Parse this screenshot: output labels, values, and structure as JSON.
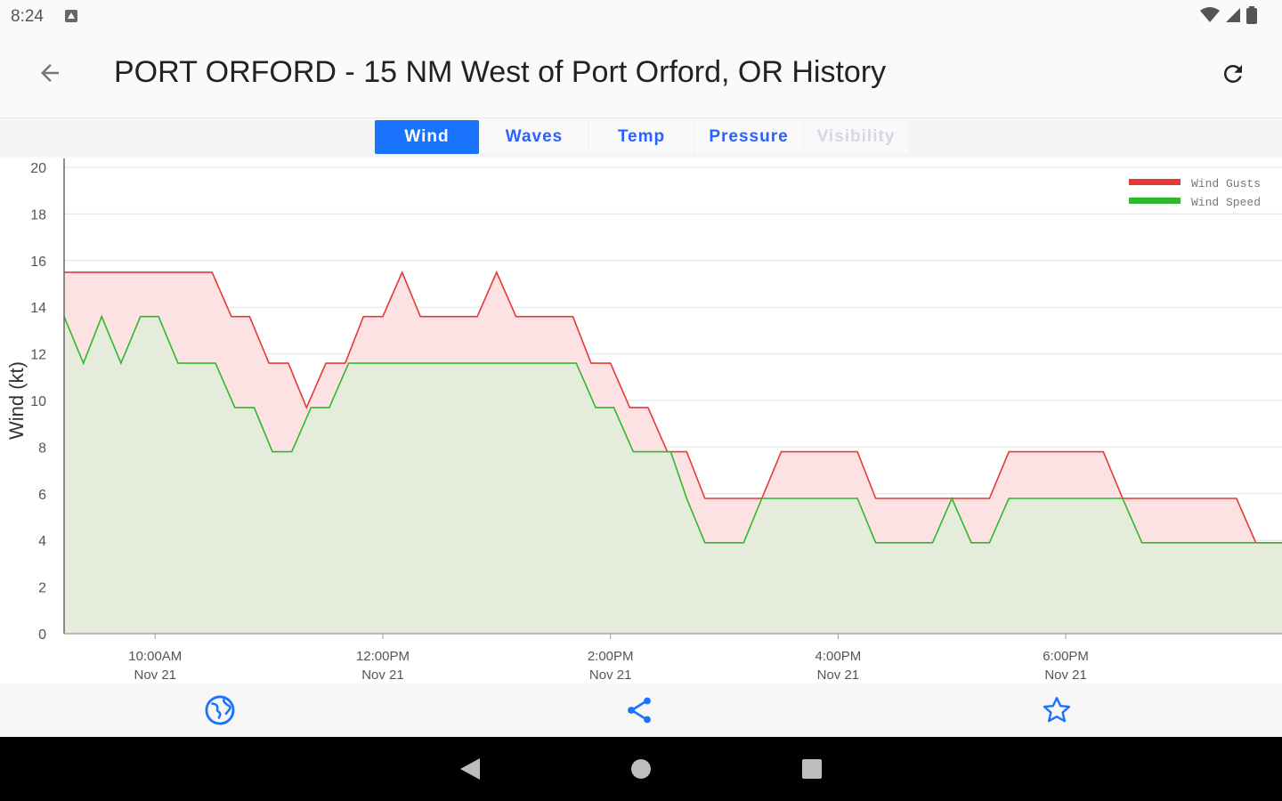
{
  "status_bar": {
    "time": "8:24"
  },
  "app_bar": {
    "title": "PORT ORFORD - 15 NM West of Port Orford, OR History"
  },
  "tabs": [
    {
      "label": "Wind",
      "state": "active"
    },
    {
      "label": "Waves",
      "state": "normal"
    },
    {
      "label": "Temp",
      "state": "normal"
    },
    {
      "label": "Pressure",
      "state": "normal"
    },
    {
      "label": "Visibility",
      "state": "disabled"
    }
  ],
  "colors": {
    "accent": "#1a73ff",
    "gust_line": "#e53935",
    "gust_fill": "#fde2e4",
    "speed_line": "#2db92d",
    "speed_fill": "#e6ecdb"
  },
  "chart_data": {
    "type": "area",
    "ylabel": "Wind (kt)",
    "xlabel": "",
    "ylim": [
      0,
      20
    ],
    "yticks": [
      0,
      2,
      4,
      6,
      8,
      10,
      12,
      14,
      16,
      18,
      20
    ],
    "xlim": [
      9.2,
      19.9
    ],
    "xticks": [
      {
        "x": 10,
        "label": "10:00AM",
        "sub": "Nov 21"
      },
      {
        "x": 12,
        "label": "12:00PM",
        "sub": "Nov 21"
      },
      {
        "x": 14,
        "label": "2:00PM",
        "sub": "Nov 21"
      },
      {
        "x": 16,
        "label": "4:00PM",
        "sub": "Nov 21"
      },
      {
        "x": 18,
        "label": "6:00PM",
        "sub": "Nov 21"
      }
    ],
    "grid": true,
    "legend_position": "top-right",
    "series": [
      {
        "name": "Wind Gusts",
        "points": [
          [
            9.2,
            15.5
          ],
          [
            10.5,
            15.5
          ],
          [
            10.67,
            13.6
          ],
          [
            10.83,
            13.6
          ],
          [
            11.0,
            11.6
          ],
          [
            11.17,
            11.6
          ],
          [
            11.33,
            9.7
          ],
          [
            11.5,
            11.6
          ],
          [
            11.67,
            11.6
          ],
          [
            11.83,
            13.6
          ],
          [
            12.0,
            13.6
          ],
          [
            12.17,
            15.5
          ],
          [
            12.33,
            13.6
          ],
          [
            12.83,
            13.6
          ],
          [
            13.0,
            15.5
          ],
          [
            13.17,
            13.6
          ],
          [
            13.67,
            13.6
          ],
          [
            13.83,
            11.6
          ],
          [
            14.0,
            11.6
          ],
          [
            14.17,
            9.7
          ],
          [
            14.33,
            9.7
          ],
          [
            14.5,
            7.8
          ],
          [
            14.67,
            7.8
          ],
          [
            14.83,
            5.8
          ],
          [
            15.33,
            5.8
          ],
          [
            15.5,
            7.8
          ],
          [
            16.17,
            7.8
          ],
          [
            16.33,
            5.8
          ],
          [
            17.33,
            5.8
          ],
          [
            17.5,
            7.8
          ],
          [
            18.33,
            7.8
          ],
          [
            18.5,
            5.8
          ],
          [
            19.5,
            5.8
          ],
          [
            19.67,
            3.9
          ],
          [
            19.9,
            3.9
          ]
        ]
      },
      {
        "name": "Wind Speed",
        "points": [
          [
            9.2,
            13.6
          ],
          [
            9.37,
            11.6
          ],
          [
            9.53,
            13.6
          ],
          [
            9.7,
            11.6
          ],
          [
            9.87,
            13.6
          ],
          [
            10.03,
            13.6
          ],
          [
            10.2,
            11.6
          ],
          [
            10.53,
            11.6
          ],
          [
            10.7,
            9.7
          ],
          [
            10.87,
            9.7
          ],
          [
            11.03,
            7.8
          ],
          [
            11.2,
            7.8
          ],
          [
            11.37,
            9.7
          ],
          [
            11.53,
            9.7
          ],
          [
            11.7,
            11.6
          ],
          [
            13.7,
            11.6
          ],
          [
            13.87,
            9.7
          ],
          [
            14.03,
            9.7
          ],
          [
            14.2,
            7.8
          ],
          [
            14.53,
            7.8
          ],
          [
            14.67,
            5.8
          ],
          [
            14.83,
            3.9
          ],
          [
            15.17,
            3.9
          ],
          [
            15.33,
            5.8
          ],
          [
            16.17,
            5.8
          ],
          [
            16.33,
            3.9
          ],
          [
            16.83,
            3.9
          ],
          [
            17.0,
            5.8
          ],
          [
            17.17,
            3.9
          ],
          [
            17.33,
            3.9
          ],
          [
            17.5,
            5.8
          ],
          [
            18.5,
            5.8
          ],
          [
            18.67,
            3.9
          ],
          [
            19.9,
            3.9
          ]
        ]
      }
    ]
  }
}
